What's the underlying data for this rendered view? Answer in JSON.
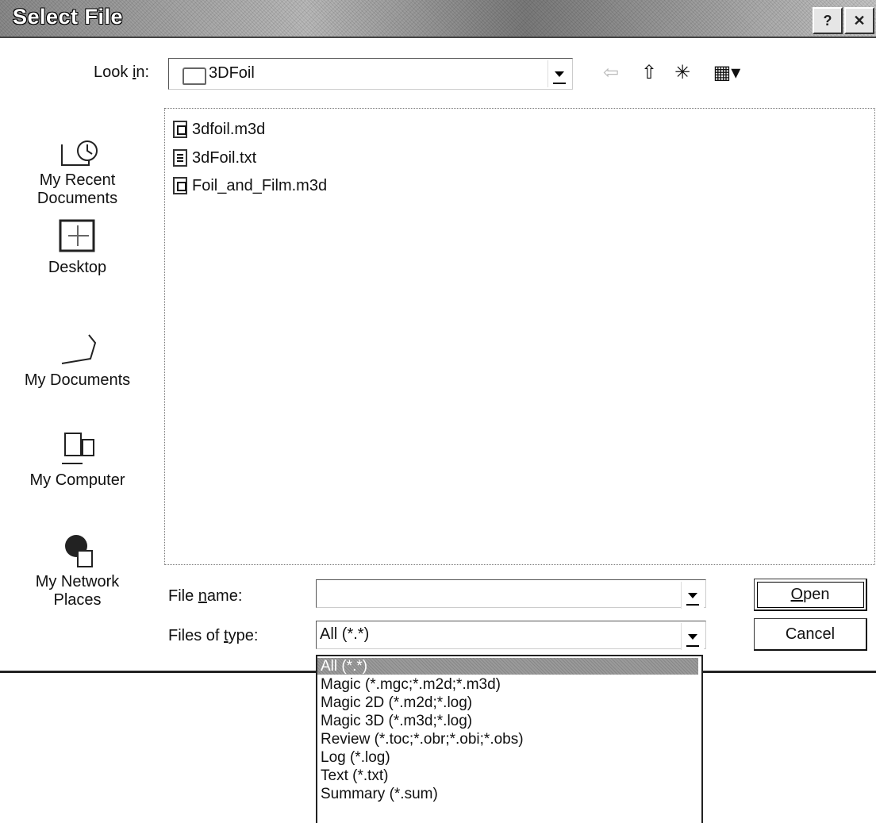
{
  "window": {
    "title": "Select File",
    "help_glyph": "?",
    "close_glyph": "✕"
  },
  "lookin": {
    "label_pre": "Look ",
    "label_u": "i",
    "label_post": "n:",
    "value": "3DFoil"
  },
  "toolbar": {
    "back_glyph": "⇦",
    "up_glyph": "⇧",
    "new_folder_glyph": "✳",
    "views_glyph": "▦▾"
  },
  "places": [
    {
      "label": "My Recent\nDocuments",
      "icon": "recent-documents-icon"
    },
    {
      "label": "Desktop",
      "icon": "desktop-icon"
    },
    {
      "label": "My Documents",
      "icon": "my-documents-icon"
    },
    {
      "label": "My Computer",
      "icon": "my-computer-icon"
    },
    {
      "label": "My Network\nPlaces",
      "icon": "network-places-icon"
    }
  ],
  "files": [
    {
      "name": "3dfoil.m3d",
      "type": "m3d"
    },
    {
      "name": "3dFoil.txt",
      "type": "txt"
    },
    {
      "name": "Foil_and_Film.m3d",
      "type": "m3d"
    }
  ],
  "filename": {
    "label_pre": "File ",
    "label_u": "n",
    "label_post": "ame:",
    "value": ""
  },
  "filetype": {
    "label_pre": "Files of ",
    "label_u": "t",
    "label_post": "ype:",
    "value": "All (*.*)"
  },
  "buttons": {
    "open_u": "O",
    "open_rest": "pen",
    "cancel": "Cancel"
  },
  "filetype_options": [
    "All (*.*)",
    "Magic (*.mgc;*.m2d;*.m3d)",
    "Magic 2D (*.m2d;*.log)",
    "Magic 3D (*.m3d;*.log)",
    "Review (*.toc;*.obr;*.obi;*.obs)",
    "Log (*.log)",
    "Text (*.txt)",
    "Summary (*.sum)"
  ],
  "selected_option_index": 0
}
